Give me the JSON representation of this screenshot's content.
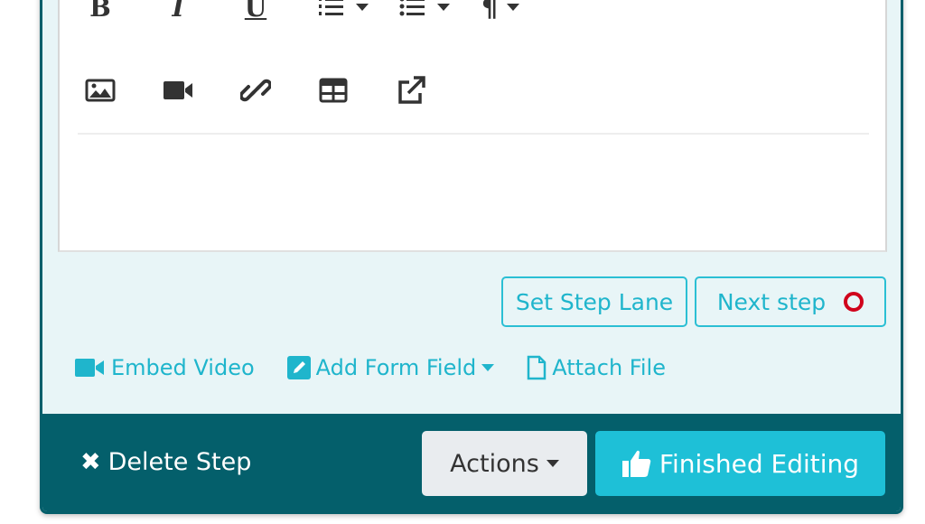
{
  "toolbar": {
    "row1": [
      "bold-icon",
      "italic-icon",
      "underline-icon",
      "ordered-list-icon",
      "unordered-list-icon",
      "paragraph-icon"
    ],
    "row2": [
      "image-icon",
      "video-icon",
      "link-icon",
      "table-icon",
      "external-link-icon"
    ],
    "bold": "B",
    "italic": "I",
    "underline": "U",
    "paragraph": "¶"
  },
  "buttons": {
    "set_step_lane": "Set Step Lane",
    "next_step": "Next step"
  },
  "links": {
    "embed_video": "Embed Video",
    "add_form_field": "Add Form Field",
    "attach_file": "Attach File"
  },
  "footer": {
    "delete_step": "Delete Step",
    "actions": "Actions",
    "finished_editing": "Finished Editing"
  },
  "colors": {
    "accent": "#1ec0d7",
    "footer": "#045f6b",
    "panel": "#e8f5f7",
    "status_ring": "#d0021b"
  }
}
